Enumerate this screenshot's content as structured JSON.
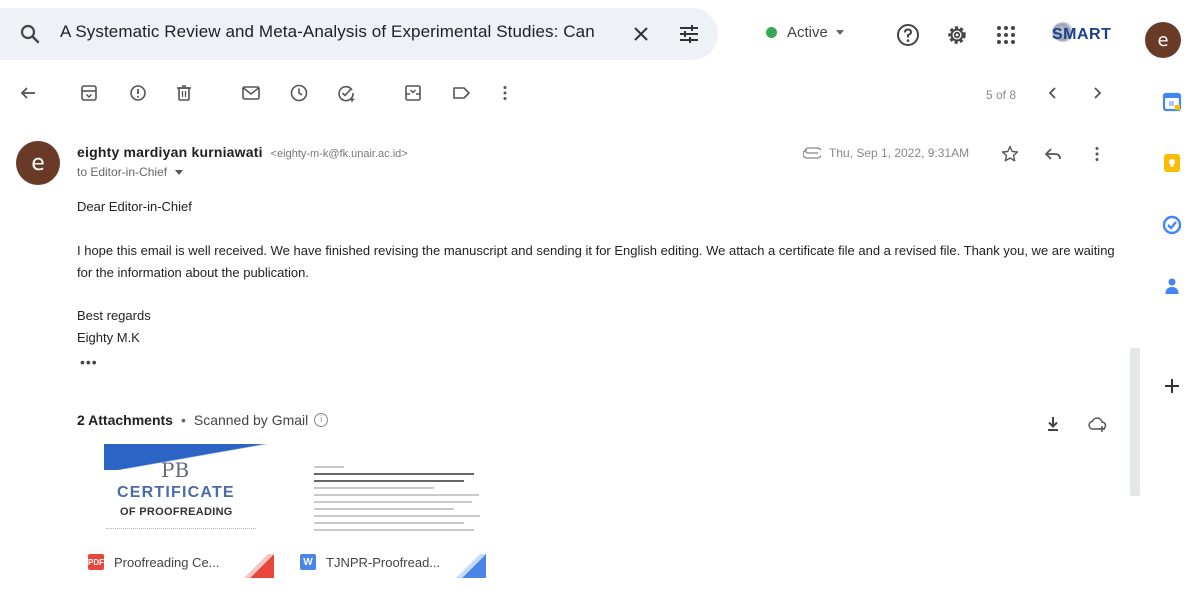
{
  "search": {
    "query": "A Systematic Review and Meta-Analysis of Experimental Studies: Can"
  },
  "status": {
    "label": "Active",
    "color": "#34a853"
  },
  "brand": {
    "text": "SMART"
  },
  "account": {
    "initial": "e"
  },
  "toolbar": {
    "pager": "5 of 8",
    "icons": [
      "back-arrow-icon",
      "archive-icon",
      "report-spam-icon",
      "delete-icon",
      "mark-unread-icon",
      "snooze-icon",
      "add-to-tasks-icon",
      "move-to-icon",
      "label-icon",
      "more-vert-icon",
      "older-chevron-icon",
      "newer-chevron-icon"
    ]
  },
  "message": {
    "sender_initial": "e",
    "sender_name": "eighty mardiyan kurniawati",
    "sender_email": "<eighty-m-k@fk.unair.ac.id>",
    "to": "to Editor-in-Chief",
    "date": "Thu, Sep 1, 2022, 9:31AM",
    "body": {
      "greeting": "Dear Editor-in-Chief",
      "paragraph": "I hope this email is well received. We have finished revising the manuscript and sending it for English editing. We attach a certificate file and a revised file. Thank you, we are waiting for the information about the publication.",
      "closing": "Best regards",
      "signature": "Eighty M.K"
    },
    "trimmed": "•••"
  },
  "attachments": {
    "count_label": "2 Attachments",
    "scanned_label": "Scanned by Gmail",
    "items": [
      {
        "name": "Proofreading Ce...",
        "type_label": "PDF",
        "preview_logo": "PB",
        "preview_title": "CERTIFICATE",
        "preview_subtitle": "OF PROOFREADING",
        "color": "#e8453c"
      },
      {
        "name": "TJNPR-Proofread...",
        "type_label": "W",
        "color": "#4a86e8"
      }
    ]
  },
  "colors": {
    "search_bg": "#eef1f6",
    "avatar": "#6a3a28",
    "brand": "#1b3f8b"
  }
}
